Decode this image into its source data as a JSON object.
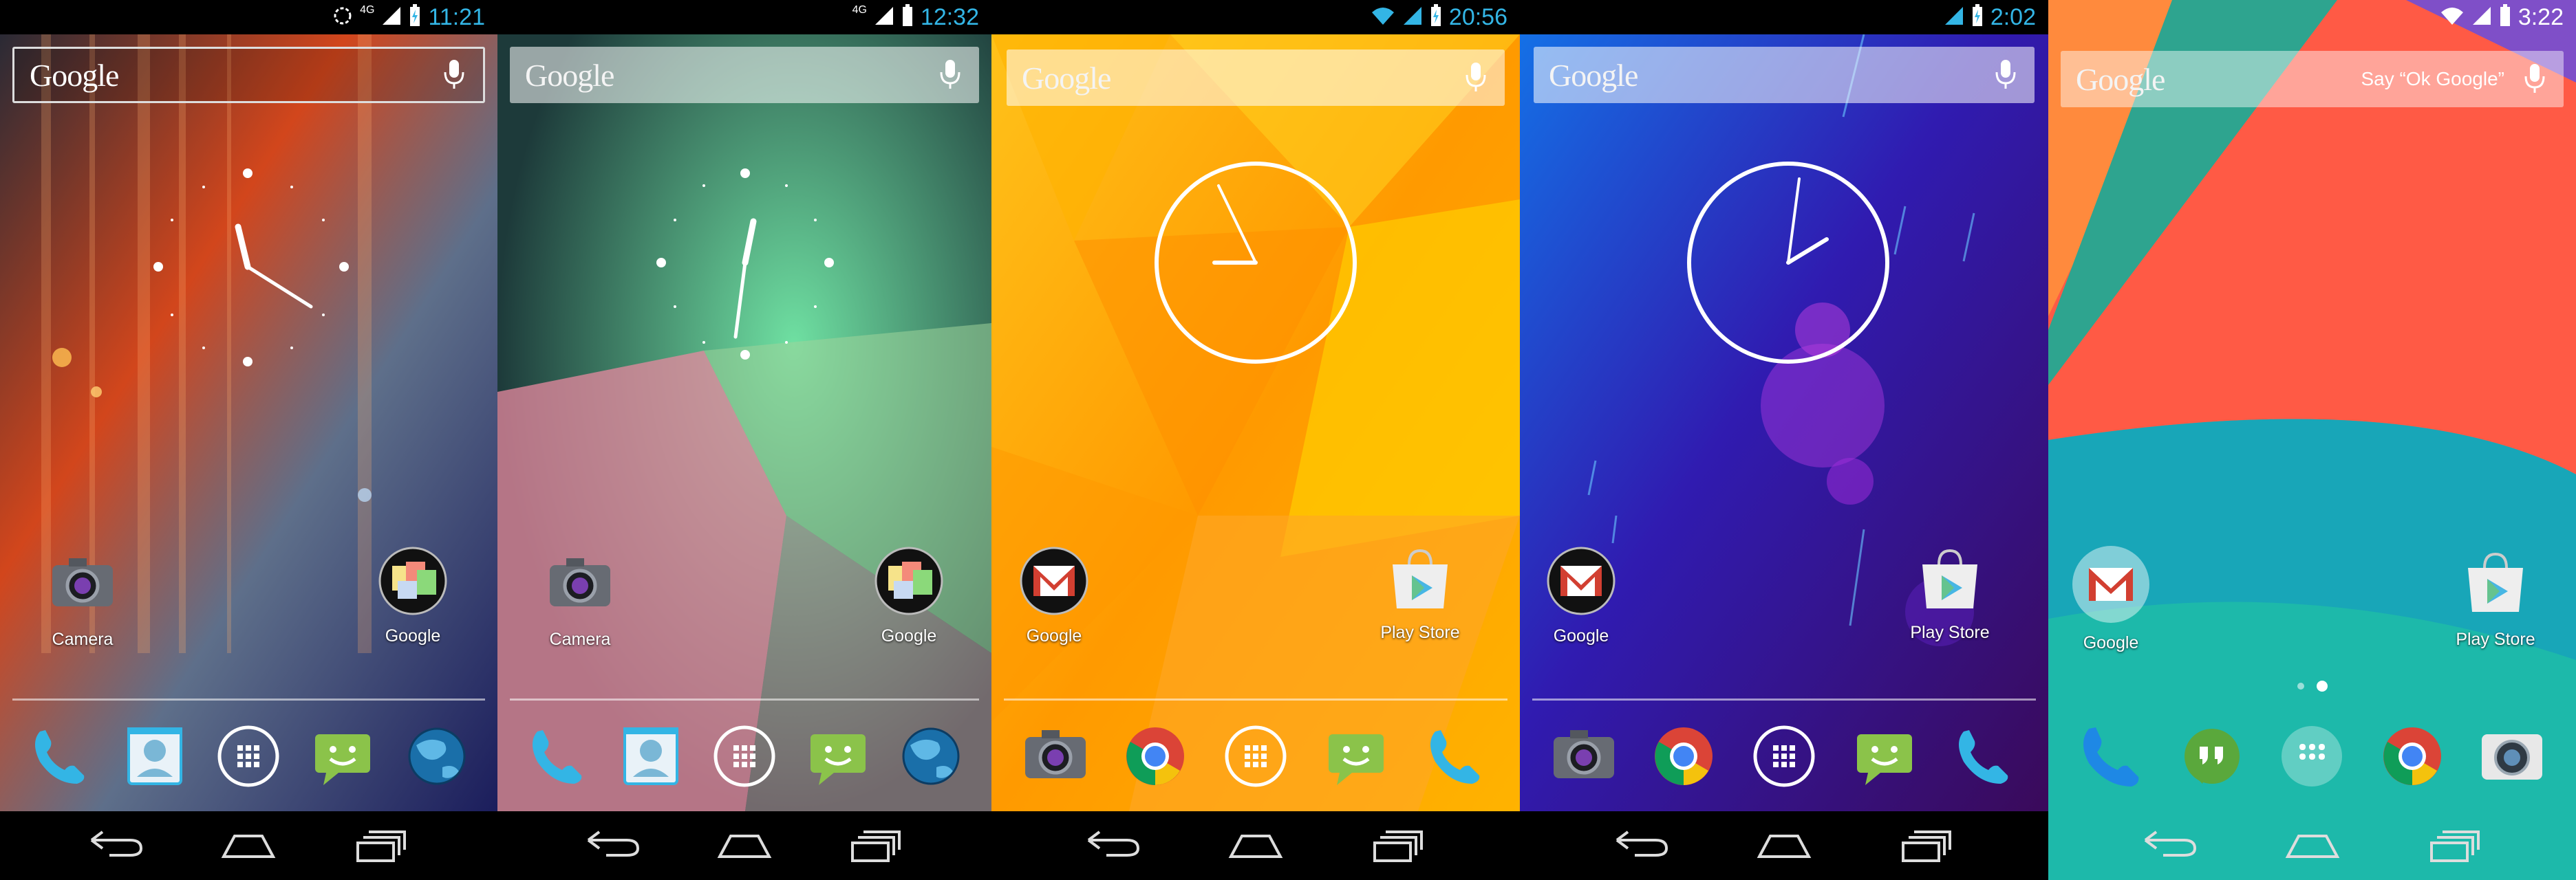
{
  "screens": [
    {
      "status": {
        "network": "4G",
        "time": "11:21",
        "time_color": "#33b5e5"
      },
      "search": {
        "logo": "Google",
        "hint": ""
      },
      "apps": [
        {
          "label": "Camera",
          "icon": "camera-icon"
        },
        {
          "label": "Google",
          "icon": "google-folder-icon"
        }
      ],
      "dock": [
        "phone-icon",
        "people-icon",
        "app-drawer-icon",
        "messaging-icon",
        "browser-globe-icon"
      ]
    },
    {
      "status": {
        "network": "4G",
        "time": "12:32",
        "time_color": "#33b5e5"
      },
      "search": {
        "logo": "Google",
        "hint": ""
      },
      "apps": [
        {
          "label": "Camera",
          "icon": "camera-icon"
        },
        {
          "label": "Google",
          "icon": "google-folder-icon"
        }
      ],
      "dock": [
        "phone-icon",
        "people-icon",
        "app-drawer-icon",
        "messaging-icon",
        "browser-globe-icon"
      ]
    },
    {
      "status": {
        "network": "",
        "time": "20:56",
        "time_color": "#33b5e5"
      },
      "search": {
        "logo": "Google",
        "hint": ""
      },
      "apps": [
        {
          "label": "Google",
          "icon": "gmail-folder-icon"
        },
        {
          "label": "Play Store",
          "icon": "play-store-icon"
        }
      ],
      "dock": [
        "camera-icon",
        "chrome-icon",
        "app-drawer-icon",
        "messaging-icon",
        "phone-icon"
      ]
    },
    {
      "status": {
        "network": "",
        "time": "2:02",
        "time_color": "#33b5e5"
      },
      "search": {
        "logo": "Google",
        "hint": ""
      },
      "apps": [
        {
          "label": "Google",
          "icon": "gmail-folder-icon"
        },
        {
          "label": "Play Store",
          "icon": "play-store-icon"
        }
      ],
      "dock": [
        "camera-icon",
        "chrome-icon",
        "app-drawer-icon",
        "messaging-icon",
        "phone-icon"
      ]
    },
    {
      "status": {
        "network": "",
        "time": "3:22",
        "time_color": "#ffffff"
      },
      "search": {
        "logo": "Google",
        "hint": "Say “Ok Google”"
      },
      "apps": [
        {
          "label": "Google",
          "icon": "gmail-folder-icon"
        },
        {
          "label": "Play Store",
          "icon": "play-store-icon"
        }
      ],
      "dock": [
        "phone-icon",
        "hangouts-icon",
        "app-drawer-icon",
        "chrome-icon",
        "camera-icon"
      ]
    }
  ],
  "nav": {
    "back": "back-icon",
    "home": "home-icon",
    "recents": "recents-icon"
  },
  "colors": {
    "holo_blue": "#33b5e5",
    "orange": "#ffa000",
    "kitkat_red": "#ff5a45"
  }
}
